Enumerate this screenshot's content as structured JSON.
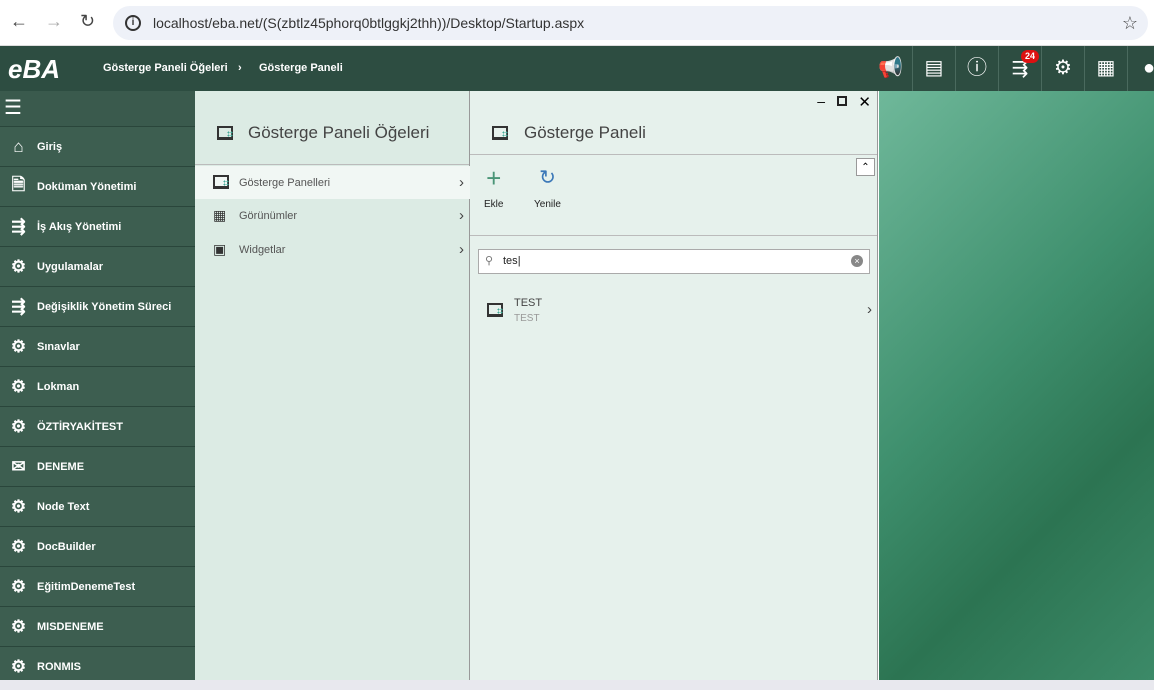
{
  "browser": {
    "url": "localhost/eba.net/(S(zbtlz45phorq0btlggkj2thh))/Desktop/Startup.aspx"
  },
  "topbar": {
    "logo": "eBA",
    "breadcrumb": [
      "Gösterge Paneli Öğeleri",
      "Gösterge Paneli"
    ],
    "notification_count": "24"
  },
  "sidebar": {
    "items": [
      {
        "label": "Giriş",
        "icon": "home-icon"
      },
      {
        "label": "Doküman Yönetimi",
        "icon": "document-gear-icon"
      },
      {
        "label": "İş Akış Yönetimi",
        "icon": "workflow-icon"
      },
      {
        "label": "Uygulamalar",
        "icon": "gears-icon"
      },
      {
        "label": "Değişiklik Yönetim Süreci",
        "icon": "workflow-icon"
      },
      {
        "label": "Sınavlar",
        "icon": "gears-icon"
      },
      {
        "label": "Lokman",
        "icon": "gears-icon"
      },
      {
        "label": "ÖZTİRYAKİTEST",
        "icon": "gears-icon"
      },
      {
        "label": "DENEME",
        "icon": "envelope-icon"
      },
      {
        "label": "Node Text",
        "icon": "gears-icon"
      },
      {
        "label": "DocBuilder",
        "icon": "gears-icon"
      },
      {
        "label": "EğitimDenemeTest",
        "icon": "gears-icon"
      },
      {
        "label": "MISDENEME",
        "icon": "gears-icon"
      },
      {
        "label": "RONMIS",
        "icon": "gears-icon"
      }
    ]
  },
  "panel1": {
    "title": "Gösterge Paneli Öğeleri",
    "items": [
      {
        "label": "Gösterge Panelleri"
      },
      {
        "label": "Görünümler"
      },
      {
        "label": "Widgetlar"
      }
    ]
  },
  "panel2": {
    "title": "Gösterge Paneli",
    "add_label": "Ekle",
    "refresh_label": "Yenile",
    "search_value": "tes",
    "results": [
      {
        "title": "TEST",
        "subtitle": "TEST"
      }
    ]
  }
}
